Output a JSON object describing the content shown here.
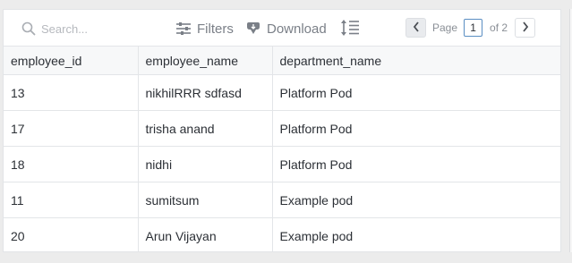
{
  "toolbar": {
    "search_placeholder": "Search...",
    "filters_label": "Filters",
    "download_label": "Download",
    "page_label": "Page",
    "current_page": "1",
    "of_label": "of 2"
  },
  "table": {
    "columns": [
      "employee_id",
      "employee_name",
      "department_name"
    ],
    "rows": [
      [
        "13",
        "nikhilRRR sdfasd",
        "Platform Pod"
      ],
      [
        "17",
        "trisha anand",
        "Platform Pod"
      ],
      [
        "18",
        "nidhi",
        "Platform Pod"
      ],
      [
        "11",
        "sumitsum",
        "Example pod"
      ],
      [
        "20",
        "Arun Vijayan",
        "Example pod"
      ]
    ]
  },
  "colors": {
    "icon_gray": "#7a7f87",
    "header_bg": "#f7f8f9",
    "border": "#e3e5e8",
    "page_input_border": "#5a8ec2"
  },
  "icons": [
    "search-icon",
    "filter-icon",
    "download-icon",
    "row-density-icon",
    "chevron-left-icon",
    "chevron-right-icon"
  ]
}
